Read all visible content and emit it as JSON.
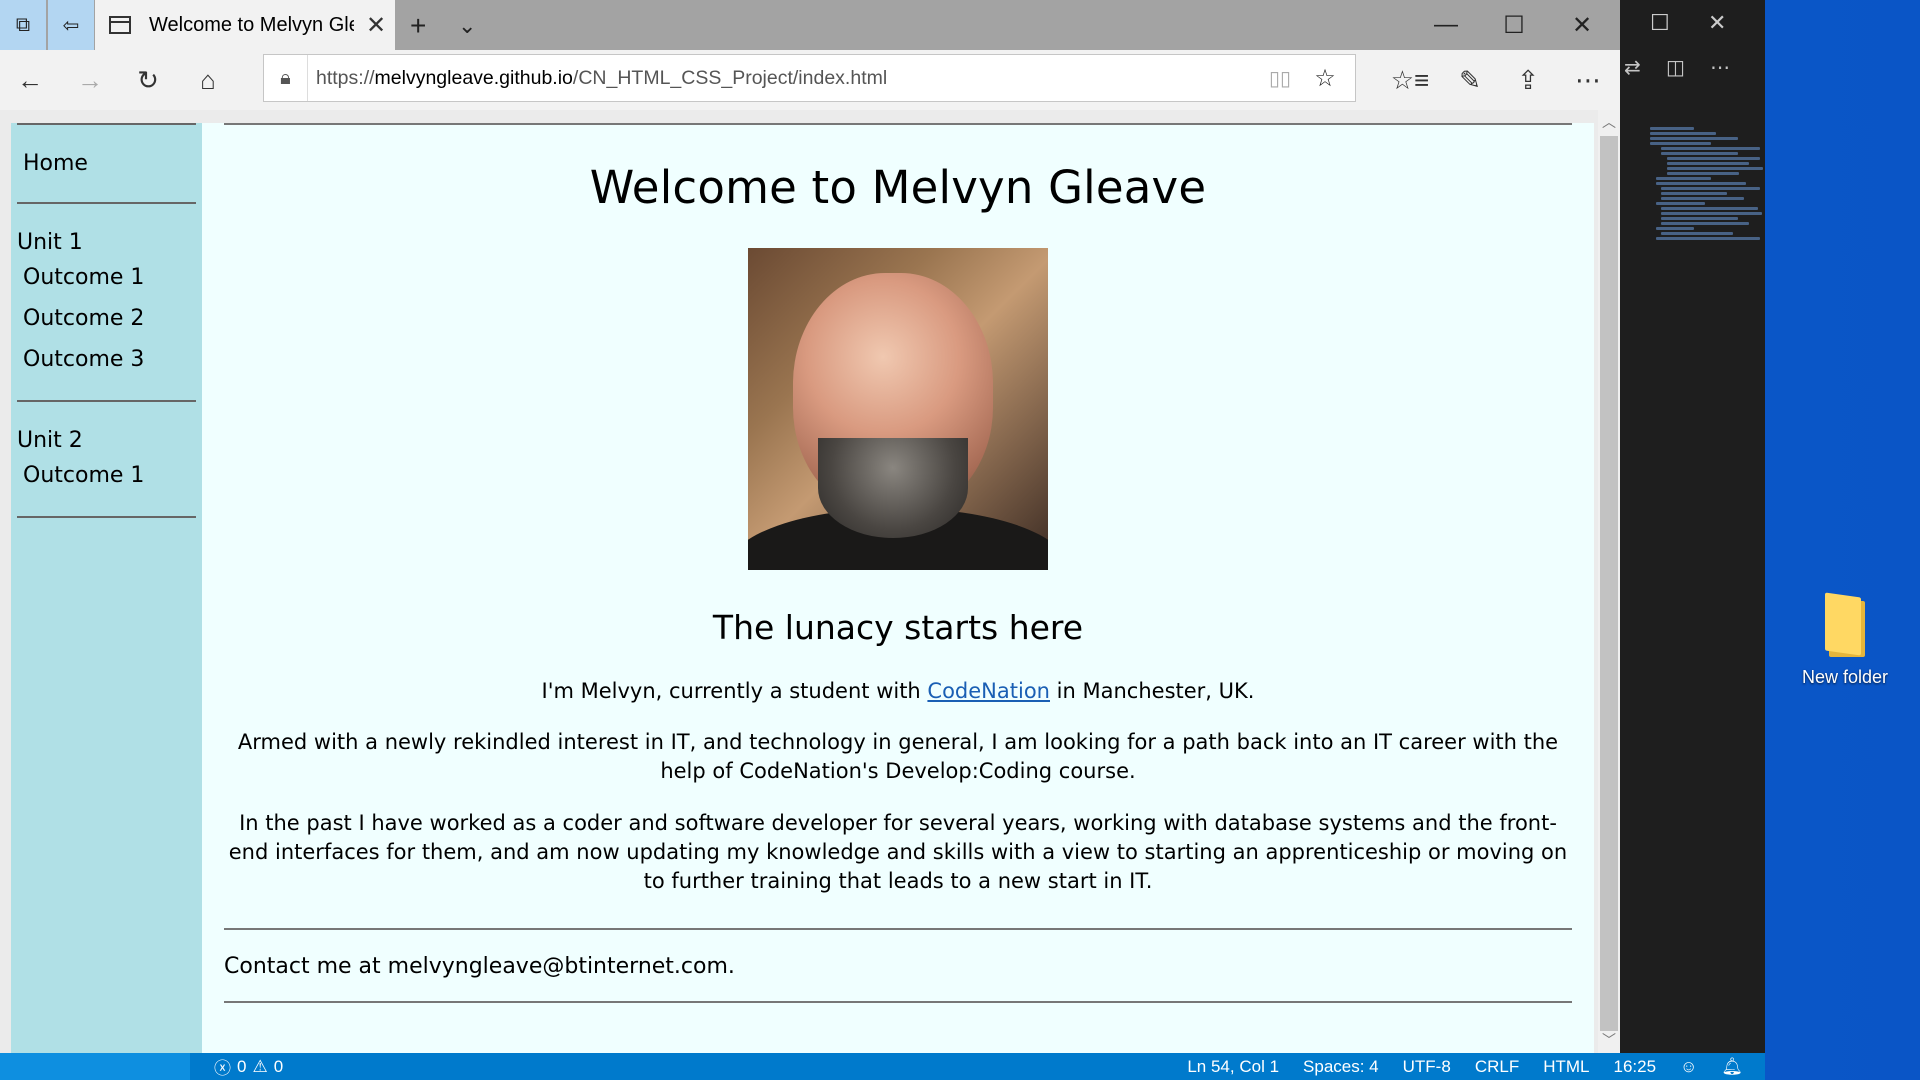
{
  "browser": {
    "tab_title": "Welcome to Melvyn Gle",
    "url_prefix": "https://",
    "url_host": "melvyngleave.github.io",
    "url_path": "/CN_HTML_CSS_Project/index.html"
  },
  "sidebar": {
    "home": "Home",
    "units": [
      {
        "title": "Unit 1",
        "outcomes": [
          "Outcome 1",
          "Outcome 2",
          "Outcome 3"
        ]
      },
      {
        "title": "Unit 2",
        "outcomes": [
          "Outcome 1"
        ]
      }
    ]
  },
  "main": {
    "heading": "Welcome to Melvyn Gleave",
    "subheading": "The lunacy starts here",
    "intro_before": "I'm Melvyn, currently a student with ",
    "intro_link": "CodeNation",
    "intro_after": " in Manchester, UK.",
    "para2": "Armed with a newly rekindled interest in IT, and technology in general, I am looking for a path back into an IT career with the help of CodeNation's Develop:Coding course.",
    "para3": "In the past I have worked as a coder and software developer for several years, working with database systems and the front-end interfaces for them, and am now updating my knowledge and skills with a view to starting an apprenticeship or moving on to further training that leads to a new start in IT.",
    "contact": "Contact me at melvyngleave@btinternet.com."
  },
  "statusbar": {
    "errors": "0",
    "warnings": "0",
    "position": "Ln 54, Col 1",
    "spaces": "Spaces: 4",
    "encoding": "UTF-8",
    "eol": "CRLF",
    "language": "HTML",
    "time": "16:25"
  },
  "desktop": {
    "folder_label": "New folder"
  },
  "icons": [
    "tab-aside-icon",
    "tab-restore-icon",
    "page-icon",
    "close-icon",
    "new-tab-icon",
    "chevron-down-icon",
    "minimize-icon",
    "maximize-icon",
    "back-icon",
    "forward-icon",
    "refresh-icon",
    "home-icon",
    "lock-icon",
    "reading-view-icon",
    "star-icon",
    "favorites-icon",
    "pen-icon",
    "share-icon",
    "more-icon",
    "error-icon",
    "warning-icon",
    "feedback-icon",
    "bell-icon",
    "folder-icon"
  ],
  "colors": {
    "sidebar_bg": "#b0e0e6",
    "main_bg": "#f0ffff",
    "statusbar_bg": "#007acc",
    "link": "#1a5fb4"
  }
}
